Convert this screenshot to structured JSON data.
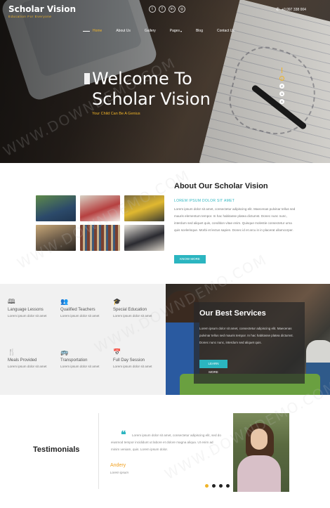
{
  "brand": {
    "name": "Scholar Vision",
    "tagline": "Education For Everyone"
  },
  "header": {
    "socials": [
      {
        "icon": "twitter-icon",
        "glyph": "t"
      },
      {
        "icon": "facebook-icon",
        "glyph": "f"
      },
      {
        "icon": "linkedin-icon",
        "glyph": "in"
      },
      {
        "icon": "dribbble-icon",
        "glyph": "◎"
      }
    ],
    "phone": "+0 097 338 004",
    "nav": [
      "Home",
      "About Us",
      "Gallery",
      "Pages",
      "Blog",
      "Contact Us"
    ],
    "active_nav": "Home"
  },
  "hero": {
    "title_line1": "Welcome To",
    "title_line2": "Scholar Vision",
    "subtitle": "Your Child Can Be A Genius",
    "slides": [
      "1",
      "2",
      "3",
      "4"
    ]
  },
  "about": {
    "title": "About Our Scholar Vision",
    "kicker": "LOREM IPSUM DOLOR SIT AMET",
    "body": "Lorem ipsum dolor sit amet, consectetur adipiscing elit. Maecenas pulvinar tellus sed mauris elementum tempor. In hac habitasse platea dictumst. Donec nunc nunc, interdum sed aliquet quis, condition vitae enim. Quisque molestie consectetur urna quis scelerisque. Morbi et lectus sapien. Donec id et arcu in in placerat ullamcorper.",
    "button": "KNOW MORE"
  },
  "services": {
    "items": [
      {
        "icon": "book-icon",
        "glyph": "🕮",
        "title": "Language Lessons",
        "desc": "Lorem ipsum dolor sit amet"
      },
      {
        "icon": "group-icon",
        "glyph": "👥",
        "title": "Qualified Teachers",
        "desc": "Lorem ipsum dolor sit amet"
      },
      {
        "icon": "graduation-cap-icon",
        "glyph": "🎓",
        "title": "Special Education",
        "desc": "Lorem ipsum dolor sit amet"
      },
      {
        "icon": "fork-knife-icon",
        "glyph": "🍴",
        "title": "Meals Provided",
        "desc": "Lorem ipsum dolor sit amet"
      },
      {
        "icon": "bus-icon",
        "glyph": "🚌",
        "title": "Transportation",
        "desc": "Lorem ipsum dolor sit amet"
      },
      {
        "icon": "calendar-icon",
        "glyph": "📅",
        "title": "Full Day Session",
        "desc": "Lorem ipsum dolor sit amet"
      }
    ],
    "box_title": "Our Best Services",
    "box_body": "Lorem ipsum dolor sit amet, consectetur adipiscing elit. Maecenas pulvinar tellus sed mauris tempor. In hac habitasse platea dictumst. Donec nunc nunc, interdum sed aliquet quis.",
    "box_button": "LEARN MORE"
  },
  "testimonials": {
    "title": "Testimonials",
    "quote": "Lorem ipsum dolor sit amet, consectetur adipiscing elit, sed do eiusmod tempor incididunt ut labore et dolore magna aliqua. Ut enim ad minim veniam, quis. Lorem ipsum dolor.",
    "name": "Andery",
    "role": "Lorem ipsum"
  },
  "watermark": "WWW.DOWNDEMO.COM"
}
